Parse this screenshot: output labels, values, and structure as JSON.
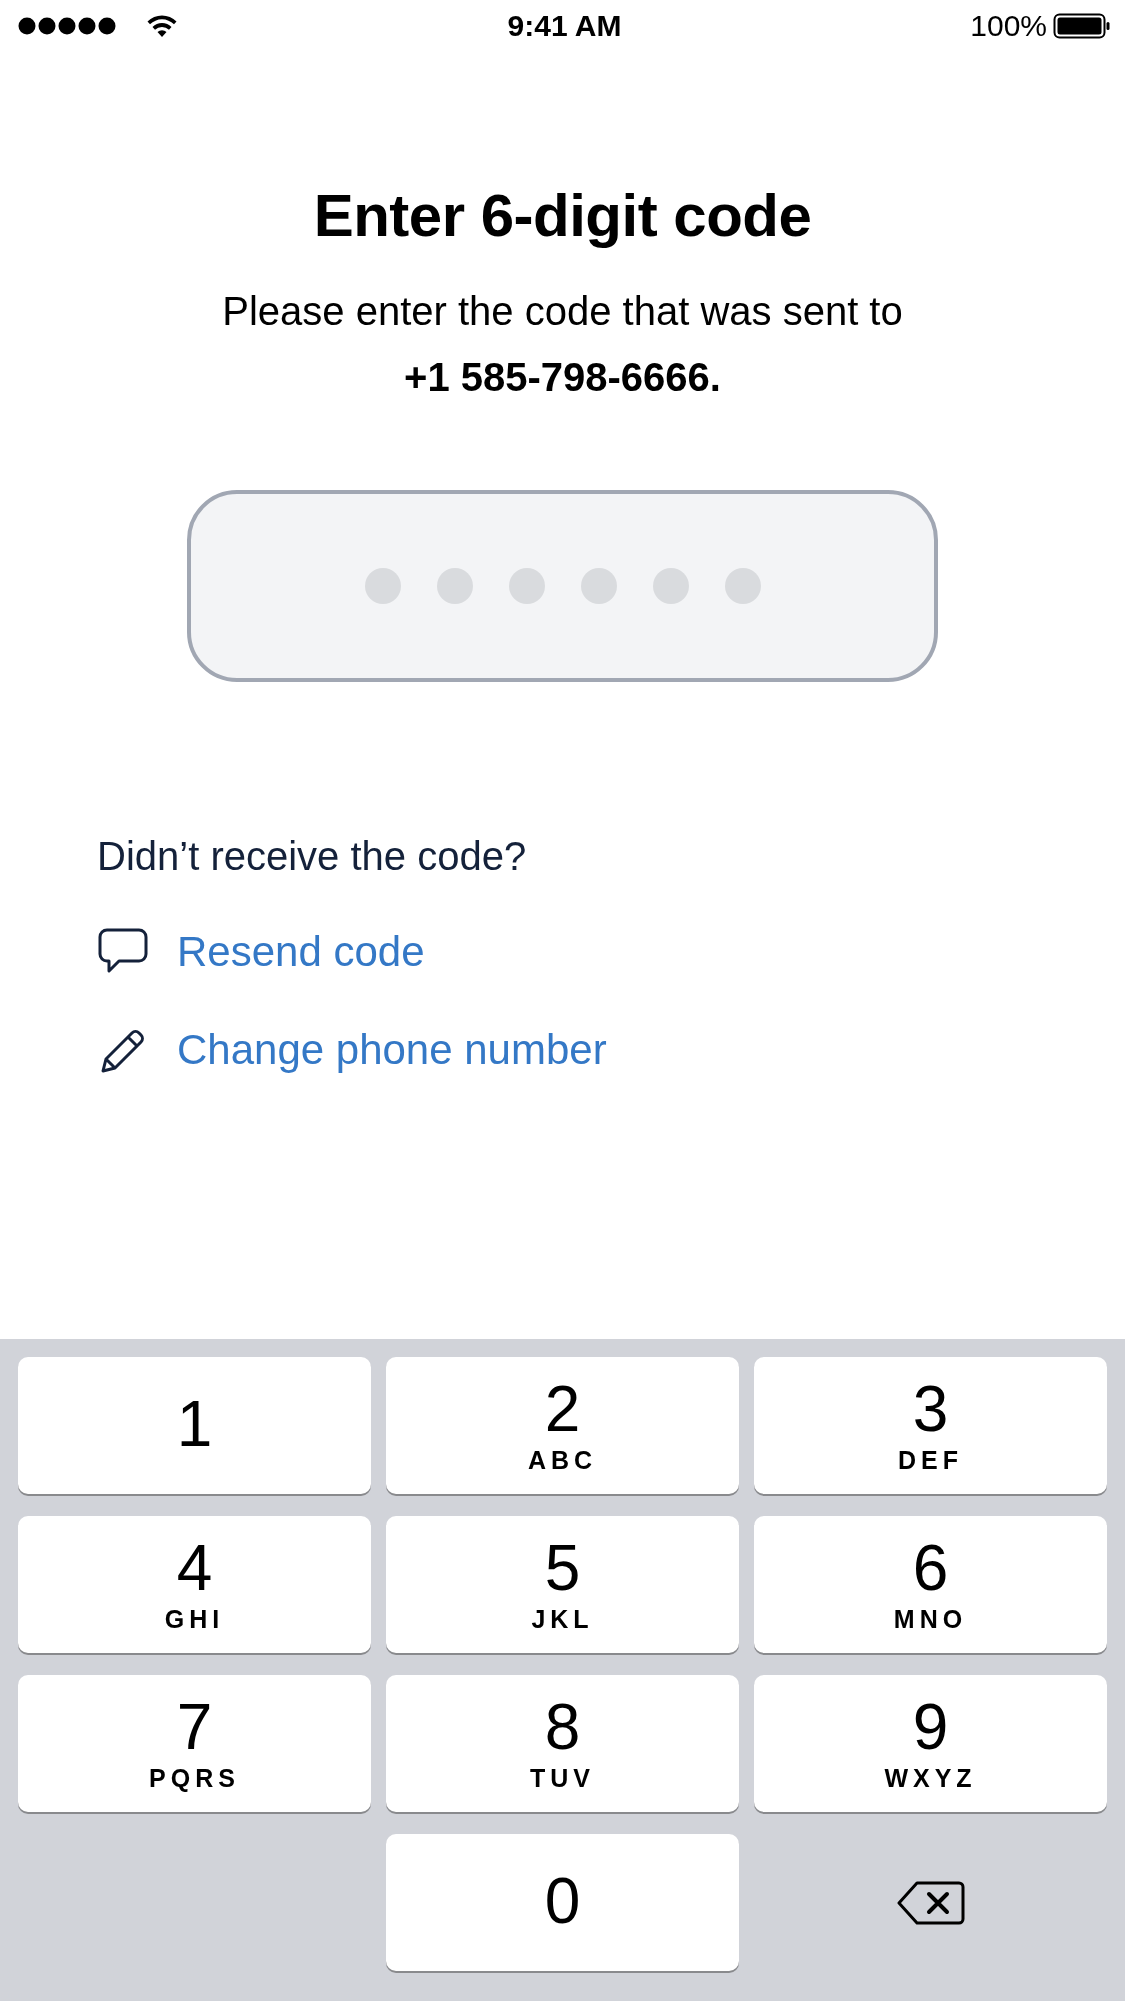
{
  "status_bar": {
    "time": "9:41 AM",
    "battery": "100%"
  },
  "title": "Enter 6-digit code",
  "message": "Please enter the code that was sent to **+1 585-798-6666.**",
  "code_field": {
    "slots": [
      {
        "filled": false
      },
      {
        "filled": false
      },
      {
        "filled": false
      },
      {
        "filled": false
      },
      {
        "filled": false
      },
      {
        "filled": false
      }
    ]
  },
  "help": {
    "question": "Didn’t receive the code?",
    "actions": [
      {
        "kind": "resend",
        "label": "Resend code"
      },
      {
        "kind": "change-phone",
        "label": "Change phone number"
      }
    ]
  },
  "keypad": {
    "keys": [
      {
        "kind": "digit",
        "digit": "1"
      },
      {
        "kind": "digit",
        "digit": "2",
        "letters": "ABC"
      },
      {
        "kind": "digit",
        "digit": "3",
        "letters": "DEF"
      },
      {
        "kind": "digit",
        "digit": "4",
        "letters": "GHI"
      },
      {
        "kind": "digit",
        "digit": "5",
        "letters": "JKL"
      },
      {
        "kind": "digit",
        "digit": "6",
        "letters": "MNO"
      },
      {
        "kind": "digit",
        "digit": "7",
        "letters": "PQRS"
      },
      {
        "kind": "digit",
        "digit": "8",
        "letters": "TUV"
      },
      {
        "kind": "digit",
        "digit": "9",
        "letters": "WXYZ"
      },
      {
        "kind": "digit",
        "digit": "0"
      },
      {
        "kind": "delete"
      }
    ]
  }
}
